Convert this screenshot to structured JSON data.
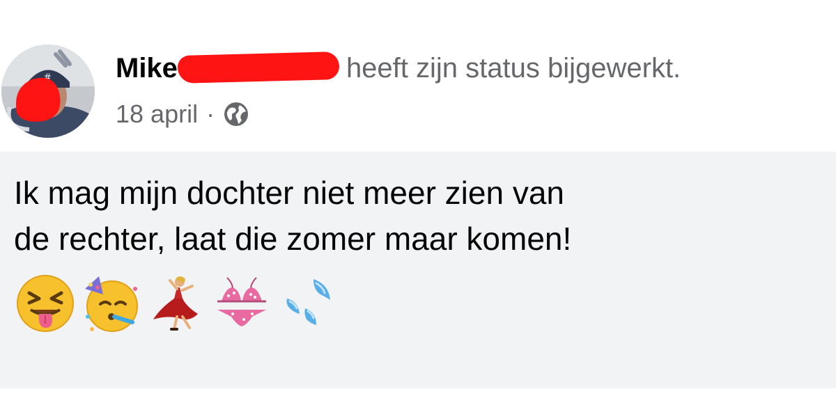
{
  "post": {
    "author": {
      "first_name": "Mike",
      "name_redacted": true,
      "action": "heeft zijn status bijgewerkt."
    },
    "meta": {
      "date": "18 april",
      "separator": "·",
      "audience_icon": "globe-icon"
    },
    "text_line_1": "Ik mag mijn dochter niet meer zien van",
    "text_line_2": "de rechter, laat die zomer maar komen!",
    "emojis": [
      "squinting-tongue-face-emoji",
      "partying-face-emoji",
      "dancer-emoji",
      "bikini-emoji",
      "sweat-droplets-emoji"
    ]
  },
  "colors": {
    "redaction": "#ff1414",
    "secondary_text": "#65676b",
    "primary_text": "#050505",
    "body_background": "#f2f3f5"
  }
}
